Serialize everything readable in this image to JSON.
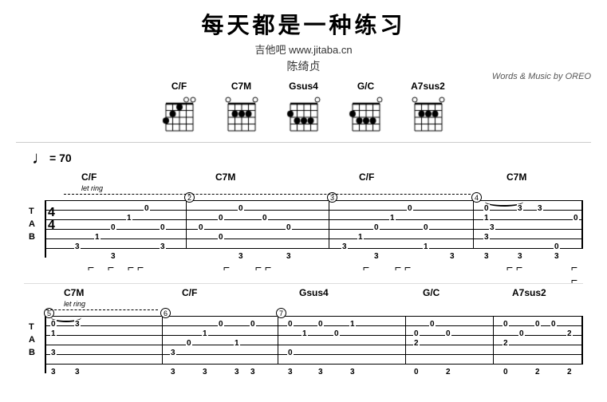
{
  "header": {
    "title": "每天都是一种练习",
    "subtitle": "吉他吧 www.jitaba.cn",
    "artist": "陈绮贞",
    "credits": "Words & Music by OREO"
  },
  "chords": [
    {
      "name": "C/F",
      "pattern": "xx_o_o"
    },
    {
      "name": "C7M",
      "pattern": "x_ooo"
    },
    {
      "name": "Gsus4",
      "pattern": "xoo_x"
    },
    {
      "name": "G/C",
      "pattern": "x_ooo"
    },
    {
      "name": "A7sus2",
      "pattern": "xo_ooo"
    }
  ],
  "tempo": "= 70",
  "tab1": {
    "chords": [
      "C/F",
      "C7M",
      "C/F",
      "C7M"
    ],
    "time_sig": "4/4"
  },
  "tab2": {
    "chords": [
      "C7M",
      "C/F",
      "Gsus4",
      "G/C",
      "A7sus2"
    ]
  }
}
